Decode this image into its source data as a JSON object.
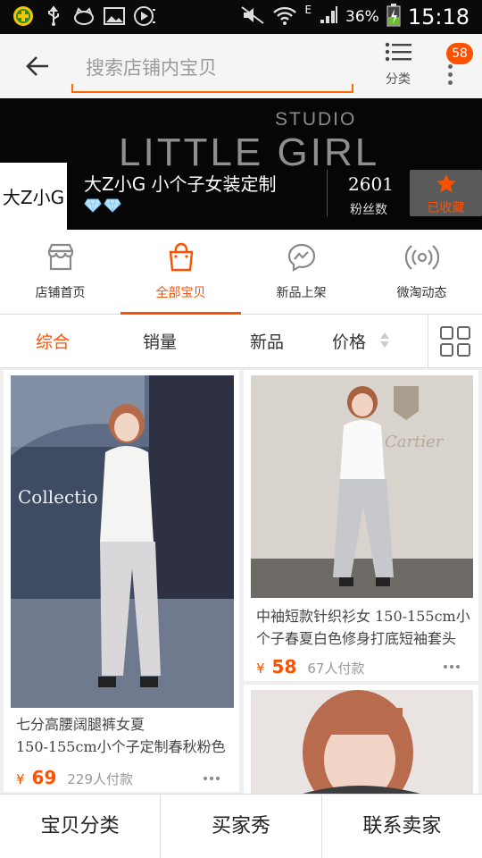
{
  "status_bar": {
    "network": "E",
    "battery": "36%",
    "time": "15:18",
    "icons": [
      "app-icon",
      "usb-icon",
      "cat-icon",
      "image-icon",
      "media-icon",
      "mute-icon",
      "wifi-icon",
      "signal-icon",
      "battery-icon"
    ]
  },
  "header": {
    "search_placeholder": "搜索店铺内宝贝",
    "category_label": "分类",
    "notification_badge": "58"
  },
  "banner": {
    "studio": "STUDIO",
    "brand": "LITTLE GIRL",
    "logo_text": "大Z小G",
    "shop_name": "大Z小G 小个子女装定制",
    "fans_count": "2601",
    "fans_label": "粉丝数",
    "favorite_label": "已收藏"
  },
  "shop_nav": [
    {
      "label": "店铺首页",
      "icon": "store-icon",
      "active": false
    },
    {
      "label": "全部宝贝",
      "icon": "shopping-bag-icon",
      "active": true
    },
    {
      "label": "新品上架",
      "icon": "chat-bubble-icon",
      "active": false
    },
    {
      "label": "微淘动态",
      "icon": "broadcast-icon",
      "active": false
    }
  ],
  "sort_bar": {
    "items": [
      "综合",
      "销量",
      "新品",
      "价格"
    ],
    "active": "综合"
  },
  "products": [
    {
      "title_line1": "七分高腰阔腿裤女夏",
      "title_line2": "150-155cm小个子定制春秋粉色",
      "currency": "¥",
      "price": "69",
      "sold": "229人付款"
    },
    {
      "title_line1": "中袖短款针织衫女 150-155cm小",
      "title_line2": "个子春夏白色修身打底短袖套头",
      "currency": "¥",
      "price": "58",
      "sold": "67人付款"
    },
    {
      "photo_text": "Collectio"
    },
    {
      "photo_text": "Cartier"
    }
  ],
  "bottom_bar": [
    "宝贝分类",
    "买家秀",
    "联系卖家"
  ],
  "colors": {
    "accent": "#ff5000",
    "banner_bg": "#060606"
  }
}
